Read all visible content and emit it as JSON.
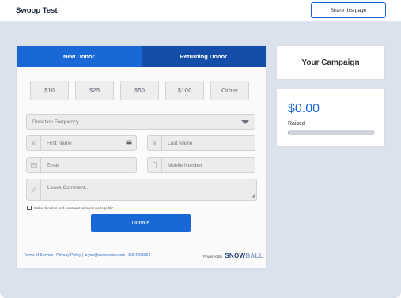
{
  "header": {
    "title": "Swoop Test",
    "share_label": "Share this page"
  },
  "tabs": [
    {
      "label": "New Donor",
      "active": true
    },
    {
      "label": "Returning Donor",
      "active": false
    }
  ],
  "amounts": [
    "$10",
    "$25",
    "$50",
    "$100",
    "Other"
  ],
  "form": {
    "frequency_placeholder": "Donation Frequency",
    "first_name_placeholder": "First Name",
    "last_name_placeholder": "Last Name",
    "email_placeholder": "Email",
    "mobile_placeholder": "Mobile Number",
    "comment_placeholder": "Leave Comment...",
    "anonymous_label": "Make donation and comment anonymous to public.",
    "donate_label": "Donate"
  },
  "footer": {
    "links": "Terms of Service | Privacy Policy | aryon@swoopnow.com | 5054003904",
    "powered_by": "Powered By",
    "brand_dark": "SNOW",
    "brand_light": "BALL"
  },
  "campaign": {
    "title": "Your Campaign",
    "amount_raised": "$0.00",
    "raised_label": "Raised",
    "progress_fraction": 0.01
  },
  "colors": {
    "accent": "#1a67d6",
    "tab_inactive": "#144ea8",
    "background": "#dbe2ee"
  },
  "icons": {
    "user": "user-icon",
    "email": "envelope-icon",
    "mobile": "phone-icon",
    "comment": "pencil-icon",
    "card": "credit-card-icon",
    "dropdown": "chevron-down-icon"
  }
}
